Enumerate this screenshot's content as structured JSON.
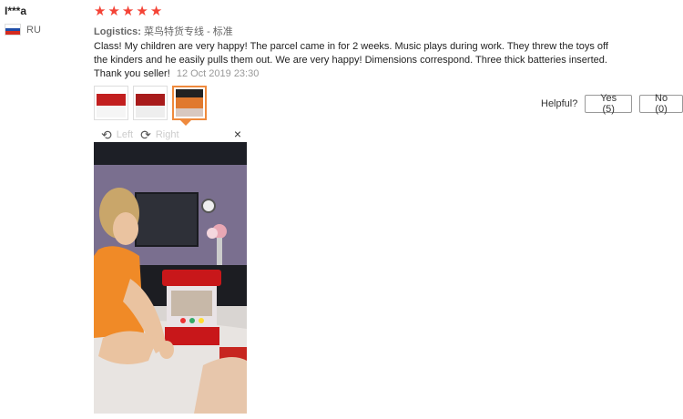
{
  "reviewer": {
    "name": "I***a",
    "country": "RU"
  },
  "rating": {
    "stars": 5,
    "max": 5
  },
  "logistics": {
    "label": "Logistics:",
    "value": "菜鸟特货专线 - 标准"
  },
  "review": {
    "text": "Class! My children are very happy! The parcel came in for 2 weeks. Music plays during work. They threw the toys off the kinders and he easily pulls them out. We are very happy! Dimensions correspond. Three thick batteries inserted. Thank you seller!",
    "date": "12 Oct 2019 23:30"
  },
  "viewer": {
    "left_label": "Left",
    "right_label": "Right",
    "close": "×"
  },
  "helpful": {
    "label": "Helpful?",
    "yes": "Yes (5)",
    "no": "No (0)"
  },
  "colors": {
    "star": "#f44336",
    "thumb_active": "#ef8a3d"
  }
}
